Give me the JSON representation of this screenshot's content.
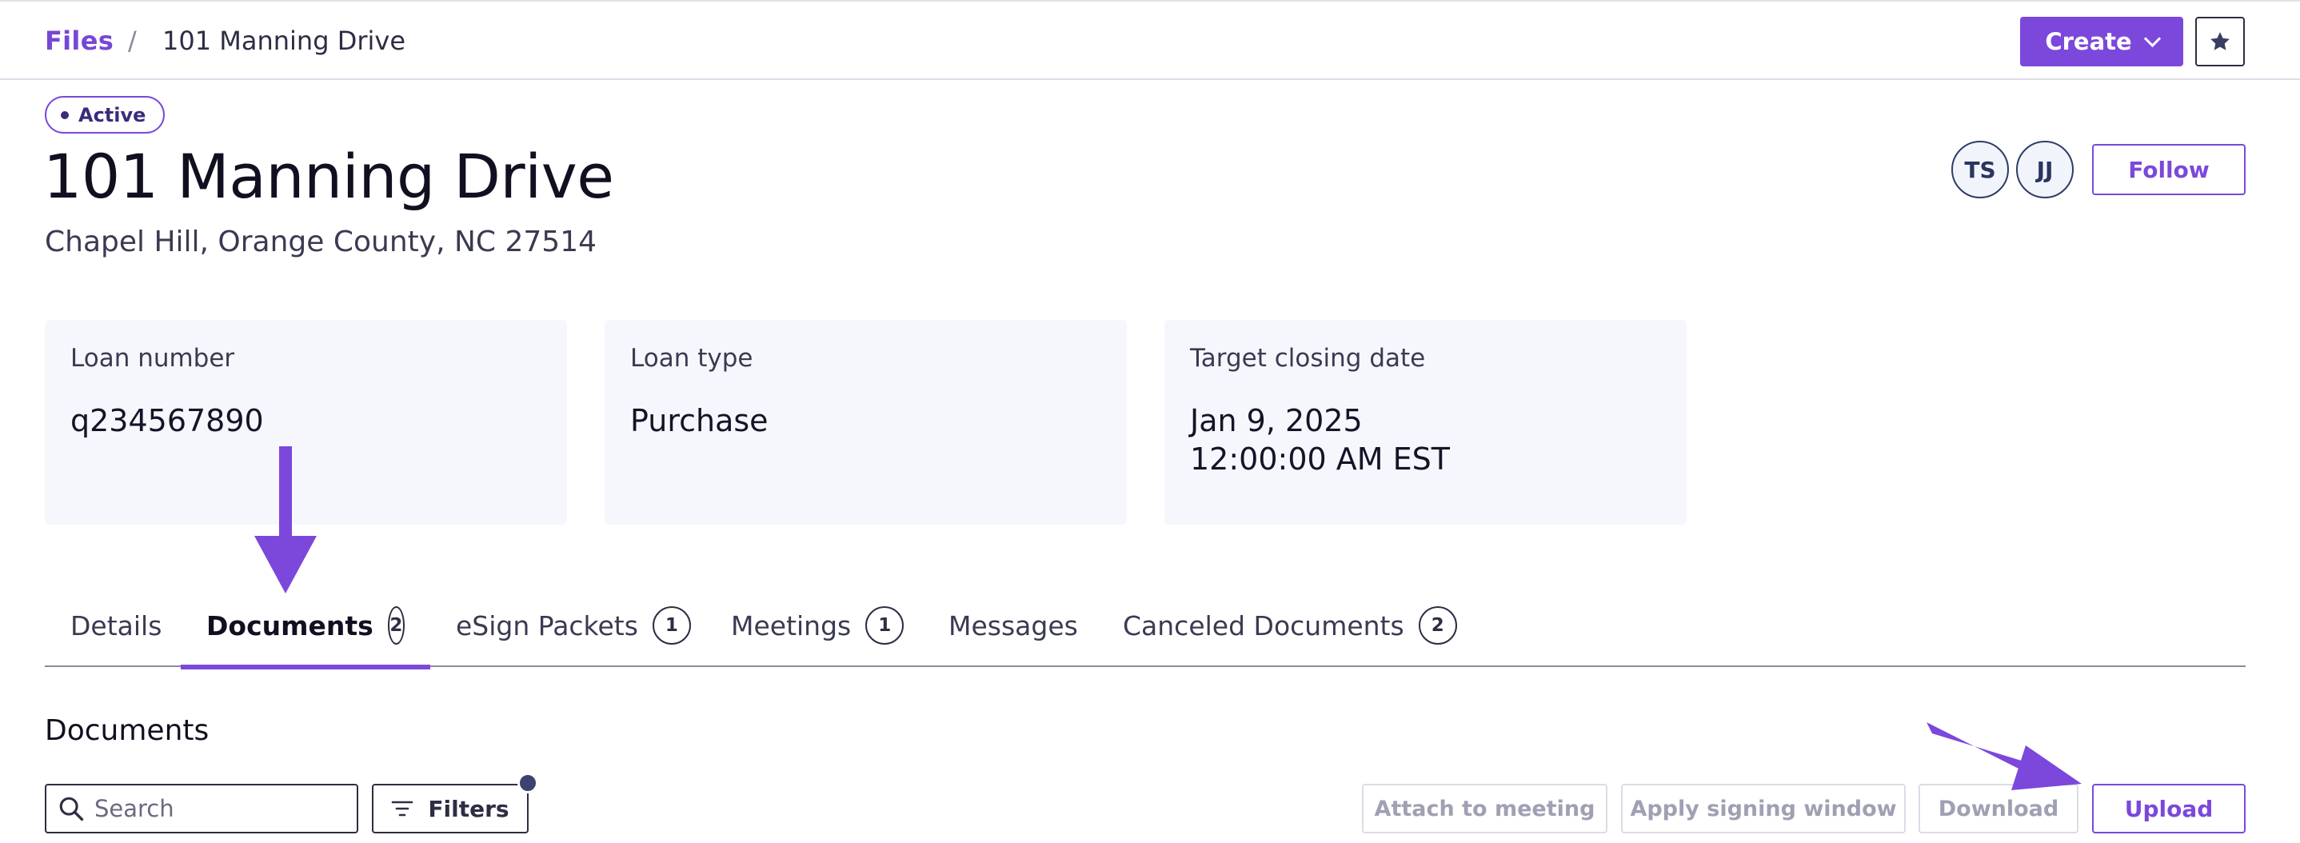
{
  "breadcrumb": {
    "root": "Files",
    "separator": "/",
    "current": "101 Manning Drive"
  },
  "header": {
    "create_label": "Create",
    "star_icon": "star-icon"
  },
  "file": {
    "status": "Active",
    "title": "101 Manning Drive",
    "address": "Chapel Hill, Orange County, NC 27514",
    "participants": [
      "TS",
      "JJ"
    ],
    "follow_label": "Follow"
  },
  "cards": [
    {
      "label": "Loan number",
      "value": "q234567890"
    },
    {
      "label": "Loan type",
      "value": "Purchase"
    },
    {
      "label": "Target closing date",
      "value_line1": "Jan 9, 2025",
      "value_line2": "12:00:00 AM EST"
    }
  ],
  "tabs": [
    {
      "label": "Details"
    },
    {
      "label": "Documents",
      "count": "2",
      "active": true
    },
    {
      "label": "eSign Packets",
      "count": "1"
    },
    {
      "label": "Meetings",
      "count": "1"
    },
    {
      "label": "Messages"
    },
    {
      "label": "Canceled Documents",
      "count": "2"
    }
  ],
  "documents": {
    "section_title": "Documents",
    "search_placeholder": "Search",
    "filters_label": "Filters",
    "actions": {
      "attach": "Attach to meeting",
      "signing_window": "Apply signing window",
      "download": "Download",
      "upload": "Upload"
    }
  },
  "colors": {
    "accent": "#7b48db",
    "annotation_arrow": "#7b48db",
    "card_bg": "#f6f7fc"
  }
}
